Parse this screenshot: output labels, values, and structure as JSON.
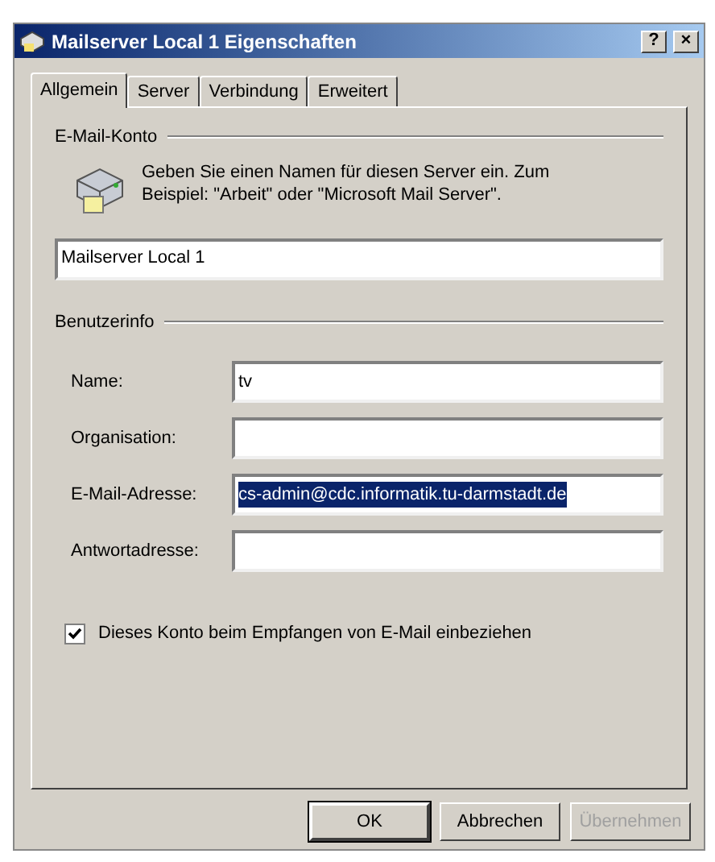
{
  "window": {
    "title": "Mailserver Local 1 Eigenschaften",
    "controls": [
      "?",
      "×"
    ]
  },
  "tabs": [
    {
      "label": "Allgemein",
      "selected": true
    },
    {
      "label": "Server",
      "selected": false
    },
    {
      "label": "Verbindung",
      "selected": false
    },
    {
      "label": "Erweitert",
      "selected": false
    }
  ],
  "account_group": {
    "title": "E-Mail-Konto",
    "description": "Geben Sie einen Namen für diesen Server ein. Zum Beispiel: \"Arbeit\" oder \"Microsoft Mail Server\".",
    "account_name": "Mailserver Local 1"
  },
  "user_group": {
    "title": "Benutzerinfo",
    "fields": [
      {
        "label": "Name:",
        "value": "tv",
        "highlighted": false
      },
      {
        "label": "Organisation:",
        "highlighted": false
      },
      {
        "label": "E-Mail-Adresse:",
        "value": "cs-admin@cdc.informatik.tu-darmstadt.de",
        "highlighted": true
      },
      {
        "label": "Antwortadresse:",
        "highlighted": false
      }
    ]
  },
  "include_checkbox": {
    "label": "Dieses Konto beim Empfangen von E-Mail einbeziehen",
    "checked": true
  },
  "buttons": [
    {
      "label": "OK",
      "default": true,
      "disabled": false
    },
    {
      "label": "Abbrechen",
      "default": false,
      "disabled": false
    },
    {
      "label": "Übernehmen",
      "default": false,
      "disabled": true
    }
  ]
}
